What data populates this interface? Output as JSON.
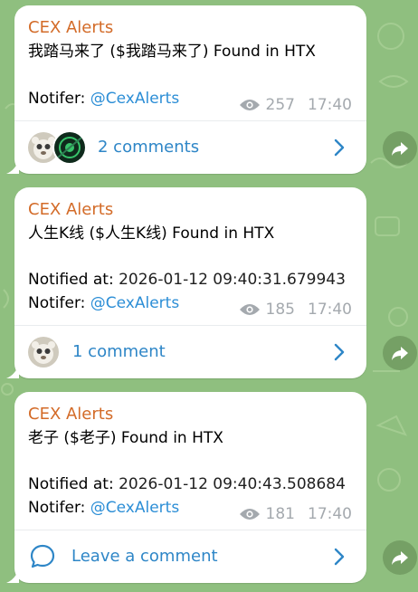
{
  "colors": {
    "sender": "#d36b28",
    "link": "#2c8ed6",
    "background": "#8fbf7f"
  },
  "messages": [
    {
      "sender": "CEX Alerts",
      "title": "我踏马来了 ($我踏马来了) Found in HTX",
      "notifier_label": "Notifer:",
      "notifier_value": "@CexAlerts",
      "views": "257",
      "time": "17:40",
      "comments_label": "2 comments"
    },
    {
      "sender": "CEX Alerts",
      "title": "人生K线 ($人生K线) Found in HTX",
      "notified_label": "Notified at:",
      "notified_value": "2026-01-12 09:40:31.679943",
      "notifier_label": "Notifer:",
      "notifier_value": "@CexAlerts",
      "views": "185",
      "time": "17:40",
      "comments_label": "1 comment"
    },
    {
      "sender": "CEX Alerts",
      "title": "老子 ($老子) Found in HTX",
      "notified_label": "Notified at:",
      "notified_value": "2026-01-12 09:40:43.508684",
      "notifier_label": "Notifer:",
      "notifier_value": "@CexAlerts",
      "views": "181",
      "time": "17:40",
      "comments_label": "Leave a comment"
    }
  ]
}
